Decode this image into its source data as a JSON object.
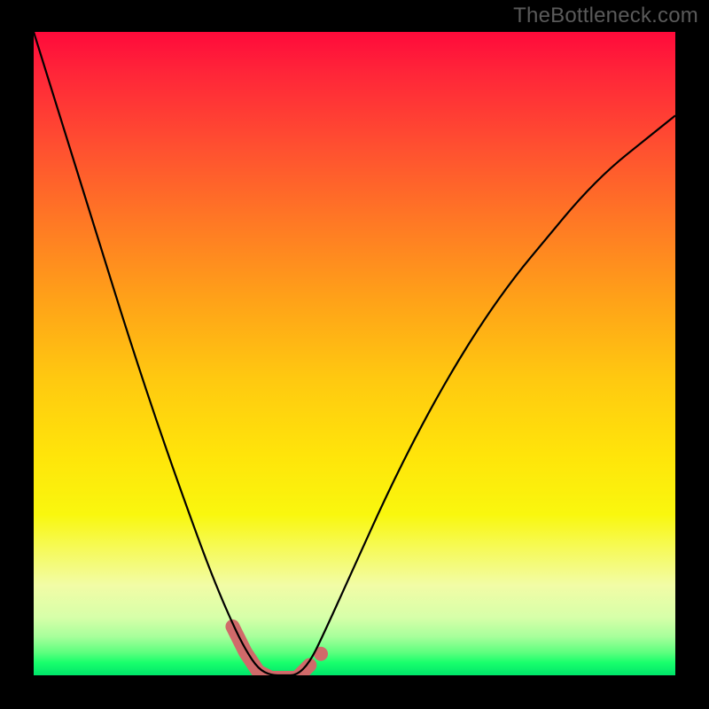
{
  "watermark": "TheBottleneck.com",
  "chart_data": {
    "type": "line",
    "title": "",
    "xlabel": "",
    "ylabel": "",
    "xlim": [
      0,
      100
    ],
    "ylim": [
      0,
      100
    ],
    "grid": false,
    "legend": false,
    "series": [
      {
        "name": "bottleneck-curve",
        "x": [
          0,
          5,
          10,
          15,
          20,
          25,
          28,
          31,
          33,
          35,
          37,
          39,
          41,
          43,
          45,
          50,
          55,
          60,
          65,
          70,
          75,
          80,
          85,
          90,
          95,
          100
        ],
        "values": [
          100,
          84,
          68,
          52,
          37,
          23,
          15,
          8,
          4,
          1,
          0,
          0,
          0,
          2,
          6,
          17,
          28,
          38,
          47,
          55,
          62,
          68,
          74,
          79,
          83,
          87
        ]
      }
    ],
    "highlight_region": {
      "x_start": 31,
      "x_end": 43,
      "description": "optimal-range"
    },
    "gradient_stops": [
      {
        "pos": 0,
        "color": "#ff0a3a"
      },
      {
        "pos": 30,
        "color": "#ff7a24"
      },
      {
        "pos": 66,
        "color": "#ffe50a"
      },
      {
        "pos": 92,
        "color": "#d7ffa9"
      },
      {
        "pos": 100,
        "color": "#00e56a"
      }
    ]
  }
}
